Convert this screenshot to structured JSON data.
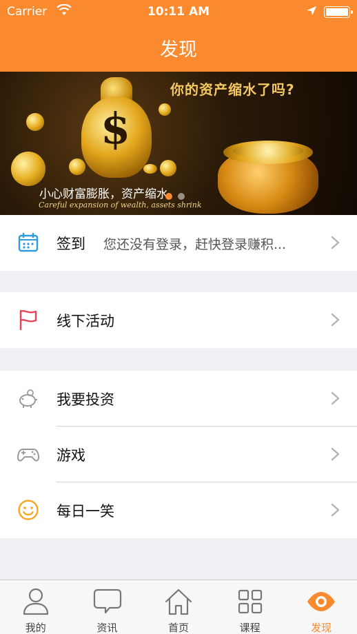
{
  "status_bar": {
    "carrier": "Carrier",
    "time": "10:11 AM"
  },
  "nav": {
    "title": "发现"
  },
  "banner": {
    "headline": "你的资产缩水了吗?",
    "caption_cn": "小心财富膨胀，资产缩水",
    "caption_en": "Careful expansion of wealth, assets shrink",
    "page_count": 2,
    "active_page": 1
  },
  "menu": {
    "checkin": {
      "label": "签到",
      "subtitle": "您还没有登录，赶快登录赚积..."
    },
    "offline": {
      "label": "线下活动"
    },
    "invest": {
      "label": "我要投资"
    },
    "games": {
      "label": "游戏"
    },
    "joke": {
      "label": "每日一笑"
    }
  },
  "tabs": [
    {
      "label": "我的",
      "icon": "person-icon"
    },
    {
      "label": "资讯",
      "icon": "chat-bubble-icon"
    },
    {
      "label": "首页",
      "icon": "home-icon"
    },
    {
      "label": "课程",
      "icon": "grid-icon"
    },
    {
      "label": "发现",
      "icon": "eye-icon"
    }
  ],
  "colors": {
    "accent": "#fb8a2e",
    "chevron": "#b3b3b3",
    "icon_blue": "#2e9bdc",
    "icon_red": "#e8455a",
    "icon_gray": "#9a9a9a",
    "icon_orange": "#f6a623"
  }
}
